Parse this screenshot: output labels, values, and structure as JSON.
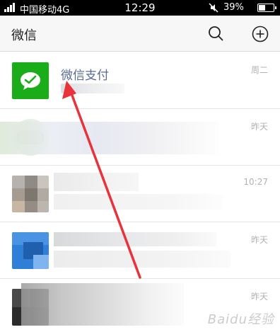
{
  "status_bar": {
    "carrier": "中国移动4G",
    "time": "12:29",
    "battery_pct": "39%",
    "battery_level": 0.39
  },
  "header": {
    "title": "微信"
  },
  "chats": [
    {
      "name": "微信支付",
      "time": "周二"
    },
    {
      "name": "",
      "time": "昨天"
    },
    {
      "name": "",
      "time": "10:27"
    },
    {
      "name": "",
      "time": "昨天"
    },
    {
      "name": "",
      "time": "昨天"
    }
  ],
  "watermark": "Baidu经验",
  "colors": {
    "pay_green": "#1aad19",
    "link_blue": "#576b95",
    "arrow_red": "#e8323c"
  }
}
